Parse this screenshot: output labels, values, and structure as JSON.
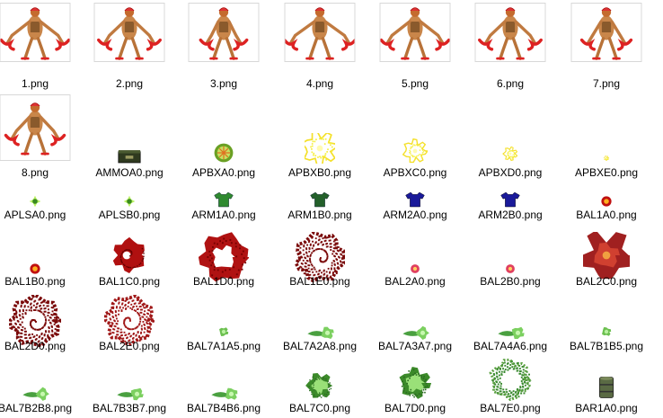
{
  "files": [
    {
      "name": "1.png",
      "icon": "demon-sprite-thumbnail"
    },
    {
      "name": "2.png",
      "icon": "demon-sprite-thumbnail"
    },
    {
      "name": "3.png",
      "icon": "demon-sprite-thumbnail"
    },
    {
      "name": "4.png",
      "icon": "demon-sprite-thumbnail"
    },
    {
      "name": "5.png",
      "icon": "demon-sprite-thumbnail"
    },
    {
      "name": "6.png",
      "icon": "demon-sprite-thumbnail"
    },
    {
      "name": "7.png",
      "icon": "demon-sprite-thumbnail"
    },
    {
      "name": "8.png",
      "icon": "demon-sprite-thumbnail"
    },
    {
      "name": "AMMOA0.png",
      "icon": "ammo-box-thumbnail"
    },
    {
      "name": "APBXA0.png",
      "icon": "green-plasma-orb-thumbnail"
    },
    {
      "name": "APBXB0.png",
      "icon": "yellow-burst-thumbnail"
    },
    {
      "name": "APBXC0.png",
      "icon": "yellow-burst-thumbnail"
    },
    {
      "name": "APBXD0.png",
      "icon": "yellow-burst-thumbnail"
    },
    {
      "name": "APBXE0.png",
      "icon": "yellow-burst-thumbnail"
    },
    {
      "name": "APLSA0.png",
      "icon": "green-plasma-ball-thumbnail"
    },
    {
      "name": "APLSB0.png",
      "icon": "green-plasma-ball-thumbnail"
    },
    {
      "name": "ARM1A0.png",
      "icon": "green-armor-thumbnail"
    },
    {
      "name": "ARM1B0.png",
      "icon": "green-armor-thumbnail"
    },
    {
      "name": "ARM2A0.png",
      "icon": "blue-armor-thumbnail"
    },
    {
      "name": "ARM2B0.png",
      "icon": "blue-armor-thumbnail"
    },
    {
      "name": "BAL1A0.png",
      "icon": "red-fireball-thumbnail"
    },
    {
      "name": "BAL1B0.png",
      "icon": "red-fireball-thumbnail"
    },
    {
      "name": "BAL1C0.png",
      "icon": "red-explosion-thumbnail"
    },
    {
      "name": "BAL1D0.png",
      "icon": "red-explosion-thumbnail"
    },
    {
      "name": "BAL1E0.png",
      "icon": "red-explosion-thumbnail"
    },
    {
      "name": "BAL2A0.png",
      "icon": "pink-fireball-thumbnail"
    },
    {
      "name": "BAL2B0.png",
      "icon": "pink-fireball-thumbnail"
    },
    {
      "name": "BAL2C0.png",
      "icon": "red-explosion-thumbnail"
    },
    {
      "name": "BAL2D0.png",
      "icon": "red-explosion-thumbnail"
    },
    {
      "name": "BAL2E0.png",
      "icon": "red-explosion-thumbnail"
    },
    {
      "name": "BAL7A1A5.png",
      "icon": "green-projectile-thumbnail"
    },
    {
      "name": "BAL7A2A8.png",
      "icon": "green-projectile-thumbnail"
    },
    {
      "name": "BAL7A3A7.png",
      "icon": "green-projectile-thumbnail"
    },
    {
      "name": "BAL7A4A6.png",
      "icon": "green-projectile-thumbnail"
    },
    {
      "name": "BAL7B1B5.png",
      "icon": "green-projectile-thumbnail"
    },
    {
      "name": "BAL7B2B8.png",
      "icon": "green-projectile-thumbnail"
    },
    {
      "name": "BAL7B3B7.png",
      "icon": "green-projectile-thumbnail"
    },
    {
      "name": "BAL7B4B6.png",
      "icon": "green-projectile-thumbnail"
    },
    {
      "name": "BAL7C0.png",
      "icon": "green-explosion-thumbnail"
    },
    {
      "name": "BAL7D0.png",
      "icon": "green-explosion-thumbnail"
    },
    {
      "name": "BAL7E0.png",
      "icon": "green-explosion-thumbnail"
    },
    {
      "name": "BAR1A0.png",
      "icon": "barrel-thumbnail"
    }
  ]
}
